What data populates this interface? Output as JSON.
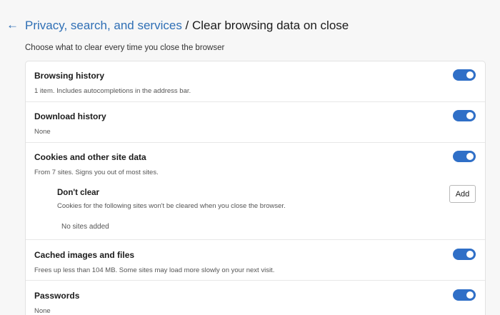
{
  "header": {
    "back_icon": "arrow-left-icon",
    "back_glyph": "←",
    "breadcrumb_parent": "Privacy, search, and services",
    "breadcrumb_separator": " / ",
    "breadcrumb_current": "Clear browsing data on close"
  },
  "subtitle": "Choose what to clear every time you close the browser",
  "items": [
    {
      "title": "Browsing history",
      "description": "1 item. Includes autocompletions in the address bar.",
      "toggle_on": true
    },
    {
      "title": "Download history",
      "description": "None",
      "toggle_on": true
    },
    {
      "title": "Cookies and other site data",
      "description": "From 7 sites. Signs you out of most sites.",
      "toggle_on": true
    },
    {
      "title": "Cached images and files",
      "description": "Frees up less than 104 MB. Some sites may load more slowly on your next visit.",
      "toggle_on": true
    },
    {
      "title": "Passwords",
      "description": "None",
      "toggle_on": true
    }
  ],
  "dont_clear": {
    "title": "Don't clear",
    "description": "Cookies for the following sites won't be cleared when you close the browser.",
    "add_label": "Add",
    "empty_text": "No sites added"
  },
  "colors": {
    "accent": "#2f6fc7",
    "link": "#2f6fb5",
    "background": "#f7f7f7",
    "card": "#ffffff"
  }
}
